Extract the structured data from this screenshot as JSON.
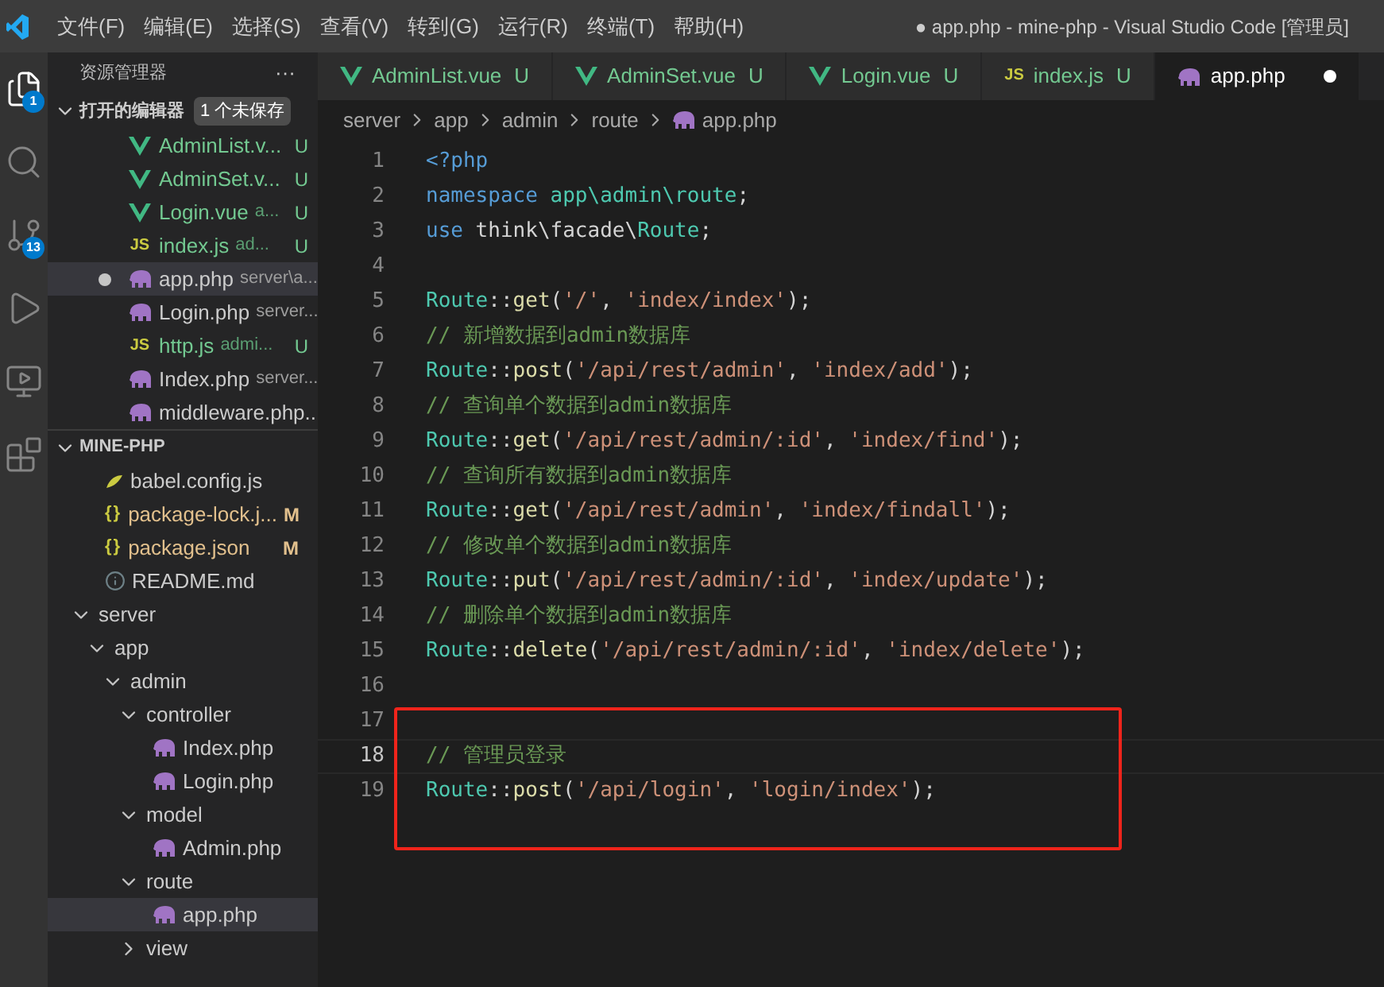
{
  "window": {
    "title": "● app.php - mine-php - Visual Studio Code [管理员]"
  },
  "menu": [
    "文件(F)",
    "编辑(E)",
    "选择(S)",
    "查看(V)",
    "转到(G)",
    "运行(R)",
    "终端(T)",
    "帮助(H)"
  ],
  "activity_bar": [
    {
      "kind": "files",
      "selected": true,
      "badge": "1"
    },
    {
      "kind": "search",
      "selected": false
    },
    {
      "kind": "source-control",
      "selected": false,
      "badge": "13"
    },
    {
      "kind": "run",
      "selected": false
    },
    {
      "kind": "remote",
      "selected": false
    },
    {
      "kind": "extensions",
      "selected": false
    }
  ],
  "sidebar": {
    "title": "资源管理器",
    "more": "···",
    "open_editors": {
      "title": "打开的编辑器",
      "expanded": true,
      "badge": "1 个未保存",
      "items": [
        {
          "kind": "vue",
          "name": "AdminList.v...",
          "status": "U",
          "dirty": false,
          "selected": false
        },
        {
          "kind": "vue",
          "name": "AdminSet.v...",
          "status": "U",
          "dirty": false,
          "selected": false
        },
        {
          "kind": "vue",
          "name": "Login.vue",
          "path": "a...",
          "status": "U",
          "dirty": false,
          "selected": false
        },
        {
          "kind": "js",
          "icon_text": "JS",
          "name": "index.js",
          "path": "ad...",
          "status": "U",
          "dirty": false,
          "selected": false
        },
        {
          "kind": "php",
          "name": "app.php",
          "path": "server\\a...",
          "dirty": true,
          "selected": true
        },
        {
          "kind": "php",
          "name": "Login.php",
          "path": "server...",
          "dirty": false,
          "selected": false
        },
        {
          "kind": "js",
          "icon_text": "JS",
          "name": "http.js",
          "path": "admi...",
          "status": "U",
          "dirty": false,
          "selected": false
        },
        {
          "kind": "php",
          "name": "Index.php",
          "path": "server...",
          "dirty": false,
          "selected": false
        },
        {
          "kind": "php",
          "name": "middleware.php...",
          "dirty": false,
          "selected": false
        }
      ]
    },
    "explorer": {
      "title": "MINE-PHP",
      "expanded": true,
      "items": [
        {
          "kind": "babel",
          "name": "babel.config.js",
          "selected": false
        },
        {
          "kind": "json",
          "icon_text": "{}",
          "name": "package-lock.j...",
          "status": "M",
          "selected": false
        },
        {
          "kind": "json",
          "icon_text": "{}",
          "name": "package.json",
          "status": "M",
          "selected": false
        },
        {
          "kind": "info",
          "name": "README.md",
          "selected": false
        },
        {
          "kind": "folder",
          "name": "server",
          "expanded": true,
          "selected": false,
          "children": [
            {
              "kind": "folder",
              "name": "app",
              "expanded": true,
              "selected": false,
              "children": [
                {
                  "kind": "folder",
                  "name": "admin",
                  "expanded": true,
                  "selected": false,
                  "children": [
                    {
                      "kind": "folder",
                      "name": "controller",
                      "expanded": true,
                      "selected": false,
                      "children": [
                        {
                          "kind": "php",
                          "name": "Index.php",
                          "selected": false
                        },
                        {
                          "kind": "php",
                          "name": "Login.php",
                          "selected": false
                        }
                      ]
                    },
                    {
                      "kind": "folder",
                      "name": "model",
                      "expanded": true,
                      "selected": false,
                      "children": [
                        {
                          "kind": "php",
                          "name": "Admin.php",
                          "selected": false
                        }
                      ]
                    },
                    {
                      "kind": "folder",
                      "name": "route",
                      "expanded": true,
                      "selected": false,
                      "children": [
                        {
                          "kind": "php",
                          "name": "app.php",
                          "selected": true
                        }
                      ]
                    },
                    {
                      "kind": "folder",
                      "name": "view",
                      "expanded": false,
                      "selected": false
                    }
                  ]
                }
              ]
            }
          ]
        }
      ]
    }
  },
  "tabs": [
    {
      "kind": "vue",
      "label": "AdminList.vue",
      "status": "U",
      "dirty": false,
      "selected": false
    },
    {
      "kind": "vue",
      "label": "AdminSet.vue",
      "status": "U",
      "dirty": false,
      "selected": false
    },
    {
      "kind": "vue",
      "label": "Login.vue",
      "status": "U",
      "dirty": false,
      "selected": false
    },
    {
      "kind": "js",
      "icon_text": "JS",
      "label": "index.js",
      "status": "U",
      "dirty": false,
      "selected": false
    },
    {
      "kind": "php",
      "label": "app.php",
      "dirty": true,
      "selected": true
    }
  ],
  "breadcrumb": [
    {
      "kind": "folder",
      "label": "server"
    },
    {
      "kind": "folder",
      "label": "app"
    },
    {
      "kind": "folder",
      "label": "admin"
    },
    {
      "kind": "folder",
      "label": "route"
    },
    {
      "kind": "php",
      "label": "app.php"
    }
  ],
  "code": [
    {
      "number": "1",
      "current": false,
      "boxed": false,
      "tokens": [
        {
          "kind": "keyword",
          "text": "<?php"
        }
      ]
    },
    {
      "number": "2",
      "current": false,
      "boxed": false,
      "tokens": [
        {
          "kind": "keyword",
          "text": "namespace "
        },
        {
          "kind": "type",
          "text": "app\\admin\\route"
        },
        {
          "kind": "plain",
          "text": ";"
        }
      ]
    },
    {
      "number": "3",
      "current": false,
      "boxed": false,
      "tokens": [
        {
          "kind": "keyword",
          "text": "use"
        },
        {
          "kind": "plain",
          "text": " think\\facade\\"
        },
        {
          "kind": "type",
          "text": "Route"
        },
        {
          "kind": "plain",
          "text": ";"
        }
      ]
    },
    {
      "number": "4",
      "current": false,
      "boxed": false
    },
    {
      "number": "5",
      "current": false,
      "boxed": false,
      "tokens": [
        {
          "kind": "type",
          "text": "Route"
        },
        {
          "kind": "plain",
          "text": "::"
        },
        {
          "kind": "function",
          "text": "get"
        },
        {
          "kind": "plain",
          "text": "("
        },
        {
          "kind": "string",
          "text": "'/'"
        },
        {
          "kind": "plain",
          "text": ", "
        },
        {
          "kind": "string",
          "text": "'index/index'"
        },
        {
          "kind": "plain",
          "text": ");"
        }
      ]
    },
    {
      "number": "6",
      "current": false,
      "boxed": false,
      "tokens": [
        {
          "kind": "comment",
          "text": "// 新增数据到admin数据库"
        }
      ]
    },
    {
      "number": "7",
      "current": false,
      "boxed": false,
      "tokens": [
        {
          "kind": "type",
          "text": "Route"
        },
        {
          "kind": "plain",
          "text": "::"
        },
        {
          "kind": "function",
          "text": "post"
        },
        {
          "kind": "plain",
          "text": "("
        },
        {
          "kind": "string",
          "text": "'/api/rest/admin'"
        },
        {
          "kind": "plain",
          "text": ", "
        },
        {
          "kind": "string",
          "text": "'index/add'"
        },
        {
          "kind": "plain",
          "text": ");"
        }
      ]
    },
    {
      "number": "8",
      "current": false,
      "boxed": false,
      "tokens": [
        {
          "kind": "comment",
          "text": "// 查询单个数据到admin数据库"
        }
      ]
    },
    {
      "number": "9",
      "current": false,
      "boxed": false,
      "tokens": [
        {
          "kind": "type",
          "text": "Route"
        },
        {
          "kind": "plain",
          "text": "::"
        },
        {
          "kind": "function",
          "text": "get"
        },
        {
          "kind": "plain",
          "text": "("
        },
        {
          "kind": "string",
          "text": "'/api/rest/admin/:id'"
        },
        {
          "kind": "plain",
          "text": ", "
        },
        {
          "kind": "string",
          "text": "'index/find'"
        },
        {
          "kind": "plain",
          "text": ");"
        }
      ]
    },
    {
      "number": "10",
      "current": false,
      "boxed": false,
      "tokens": [
        {
          "kind": "comment",
          "text": "// 查询所有数据到admin数据库"
        }
      ]
    },
    {
      "number": "11",
      "current": false,
      "boxed": false,
      "tokens": [
        {
          "kind": "type",
          "text": "Route"
        },
        {
          "kind": "plain",
          "text": "::"
        },
        {
          "kind": "function",
          "text": "get"
        },
        {
          "kind": "plain",
          "text": "("
        },
        {
          "kind": "string",
          "text": "'/api/rest/admin'"
        },
        {
          "kind": "plain",
          "text": ", "
        },
        {
          "kind": "string",
          "text": "'index/findall'"
        },
        {
          "kind": "plain",
          "text": ");"
        }
      ]
    },
    {
      "number": "12",
      "current": false,
      "boxed": false,
      "tokens": [
        {
          "kind": "comment",
          "text": "// 修改单个数据到admin数据库"
        }
      ]
    },
    {
      "number": "13",
      "current": false,
      "boxed": false,
      "tokens": [
        {
          "kind": "type",
          "text": "Route"
        },
        {
          "kind": "plain",
          "text": "::"
        },
        {
          "kind": "function",
          "text": "put"
        },
        {
          "kind": "plain",
          "text": "("
        },
        {
          "kind": "string",
          "text": "'/api/rest/admin/:id'"
        },
        {
          "kind": "plain",
          "text": ", "
        },
        {
          "kind": "string",
          "text": "'index/update'"
        },
        {
          "kind": "plain",
          "text": ");"
        }
      ]
    },
    {
      "number": "14",
      "current": false,
      "boxed": false,
      "tokens": [
        {
          "kind": "comment",
          "text": "// 删除单个数据到admin数据库"
        }
      ]
    },
    {
      "number": "15",
      "current": false,
      "boxed": false,
      "tokens": [
        {
          "kind": "type",
          "text": "Route"
        },
        {
          "kind": "plain",
          "text": "::"
        },
        {
          "kind": "function",
          "text": "delete"
        },
        {
          "kind": "plain",
          "text": "("
        },
        {
          "kind": "string",
          "text": "'/api/rest/admin/:id'"
        },
        {
          "kind": "plain",
          "text": ", "
        },
        {
          "kind": "string",
          "text": "'index/delete'"
        },
        {
          "kind": "plain",
          "text": ");"
        }
      ]
    },
    {
      "number": "16",
      "current": false,
      "boxed": false
    },
    {
      "number": "17",
      "current": false,
      "boxed": false
    },
    {
      "number": "18",
      "current": true,
      "boxed": true,
      "tokens": [
        {
          "kind": "comment",
          "text": "// 管理员登录"
        }
      ]
    },
    {
      "number": "19",
      "current": false,
      "boxed": true,
      "tokens": [
        {
          "kind": "type",
          "text": "Route"
        },
        {
          "kind": "plain",
          "text": "::"
        },
        {
          "kind": "function",
          "text": "post"
        },
        {
          "kind": "plain",
          "text": "("
        },
        {
          "kind": "string",
          "text": "'/api/login'"
        },
        {
          "kind": "plain",
          "text": ", "
        },
        {
          "kind": "string",
          "text": "'login/index'"
        },
        {
          "kind": "plain",
          "text": ");"
        }
      ]
    }
  ]
}
